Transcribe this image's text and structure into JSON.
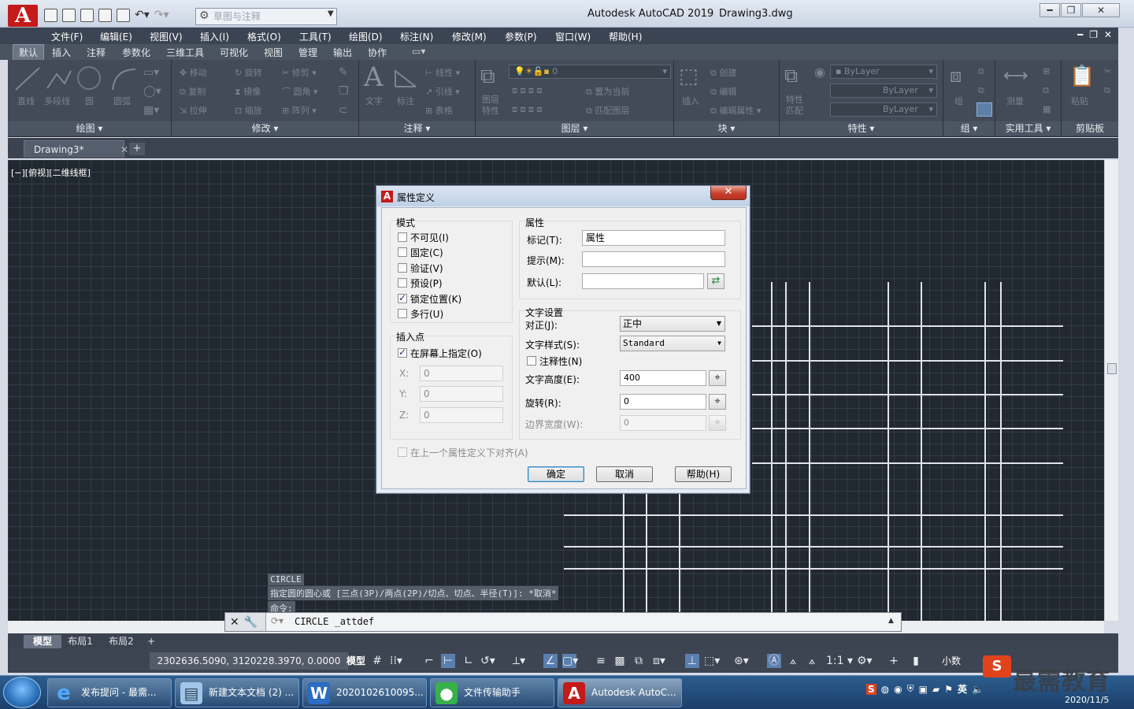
{
  "titlebar": {
    "app_title": "Autodesk AutoCAD 2019",
    "doc_title": "Drawing3.dwg",
    "workspace": "草图与注释",
    "logo": "A",
    "min": "━",
    "max": "❐",
    "close": "✕"
  },
  "menus": [
    "文件(F)",
    "编辑(E)",
    "视图(V)",
    "插入(I)",
    "格式(O)",
    "工具(T)",
    "绘图(D)",
    "标注(N)",
    "修改(M)",
    "参数(P)",
    "窗口(W)",
    "帮助(H)"
  ],
  "ribbon_tabs": [
    "默认",
    "插入",
    "注释",
    "参数化",
    "三维工具",
    "可视化",
    "视图",
    "管理",
    "输出",
    "协作"
  ],
  "ribbon": {
    "draw": {
      "label": "绘图 ▾",
      "items": [
        "直线",
        "多段线",
        "圆",
        "圆弧"
      ]
    },
    "modify": {
      "label": "修改 ▾",
      "items": [
        "移动",
        "旋转",
        "修剪",
        "复制",
        "镜像",
        "圆角",
        "拉伸",
        "缩放",
        "阵列"
      ]
    },
    "annotation": {
      "label": "注释 ▾",
      "items": [
        "文字",
        "标注",
        "线性",
        "引线",
        "表格"
      ]
    },
    "layers": {
      "label": "图层 ▾",
      "layer_value": "0",
      "items": [
        "图层特性",
        "置为当前",
        "匹配图层"
      ]
    },
    "block": {
      "label": "块 ▾",
      "items": [
        "插入",
        "创建",
        "编辑",
        "编辑属性"
      ]
    },
    "properties": {
      "label": "特性 ▾",
      "items": [
        "特性匹配"
      ],
      "color": "ByLayer",
      "linetype": "ByLayer",
      "lineweight": "ByLayer"
    },
    "group": {
      "label": "组 ▾",
      "items": [
        "组"
      ]
    },
    "utilities": {
      "label": "实用工具 ▾",
      "items": [
        "测量"
      ]
    },
    "clipboard": {
      "label": "剪贴板",
      "items": [
        "粘贴"
      ]
    }
  },
  "file_tab": {
    "name": "Drawing3*",
    "close": "✕",
    "add": "+"
  },
  "viewport_label": "[−][俯视][二维线框]",
  "command_history": [
    "CIRCLE",
    "指定圆的圆心或 [三点(3P)/两点(2P)/切点、切点、半径(T)]: *取消*",
    "命令:"
  ],
  "command_line": "CIRCLE _attdef",
  "layout_tabs": [
    "模型",
    "布局1",
    "布局2"
  ],
  "layout_add": "+",
  "statusbar": {
    "coords": "2302636.5090, 3120228.3970, 0.0000",
    "model": "模型",
    "scale": "1:1",
    "units": "小数"
  },
  "dialog": {
    "title": "属性定义",
    "close": "✕",
    "mode": {
      "label": "模式",
      "options": [
        {
          "label": "不可见(I)",
          "checked": false
        },
        {
          "label": "固定(C)",
          "checked": false
        },
        {
          "label": "验证(V)",
          "checked": false
        },
        {
          "label": "预设(P)",
          "checked": false
        },
        {
          "label": "锁定位置(K)",
          "checked": true
        },
        {
          "label": "多行(U)",
          "checked": false
        }
      ]
    },
    "attribute": {
      "label": "属性",
      "tag_label": "标记(T):",
      "tag_value": "属性",
      "prompt_label": "提示(M):",
      "prompt_value": "",
      "default_label": "默认(L):",
      "default_value": ""
    },
    "insertion": {
      "label": "插入点",
      "on_screen_label": "在屏幕上指定(O)",
      "on_screen_checked": true,
      "x_label": "X:",
      "x_value": "0",
      "y_label": "Y:",
      "y_value": "0",
      "z_label": "Z:",
      "z_value": "0"
    },
    "text_settings": {
      "label": "文字设置",
      "justify_label": "对正(J):",
      "justify_value": "正中",
      "style_label": "文字样式(S):",
      "style_value": "Standard",
      "annotative_label": "注释性(N)",
      "annotative_checked": false,
      "height_label": "文字高度(E):",
      "height_value": "400",
      "rotation_label": "旋转(R):",
      "rotation_value": "0",
      "boundary_label": "边界宽度(W):",
      "boundary_value": "0"
    },
    "align_below_label": "在上一个属性定义下对齐(A)",
    "align_below_checked": false,
    "ok": "确定",
    "cancel": "取消",
    "help": "帮助(H)"
  },
  "taskbar": {
    "items": [
      "发布提问 - 最需...",
      "新建文本文档 (2) ...",
      "2020102610095...",
      "文件传输助手",
      "Autodesk AutoC..."
    ],
    "tray_lang": "英",
    "date": "2020/11/5"
  },
  "watermark": {
    "badge": "S",
    "text": "最需教育"
  },
  "colors": {
    "canvas_bg": "#212830",
    "accent_red": "#c41a1a",
    "ribbon_bg": "#434b58"
  }
}
